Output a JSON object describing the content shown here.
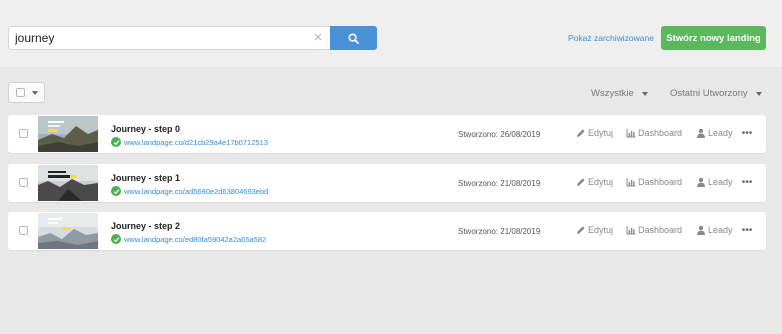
{
  "search": {
    "value": "journey",
    "clear_symbol": "×"
  },
  "header": {
    "archived_link": "Pokaż zarchiwizowane",
    "create_button": "Stwórz nowy landing"
  },
  "filters": {
    "status": "Wszystkie",
    "sort": "Ostatni Utworzony"
  },
  "actions": {
    "edit": "Edytuj",
    "dashboard": "Dashboard",
    "leads": "Leady",
    "more": "•••"
  },
  "landings": [
    {
      "name": "Journey - step 0",
      "url": "www.landpage.co/d21cb29a4e17b0712513",
      "created": "Stworzono: 26/08/2019"
    },
    {
      "name": "Journey - step 1",
      "url": "www.landpage.co/ad5690e2d63804693ebd",
      "created": "Stworzono: 21/08/2019"
    },
    {
      "name": "Journey - step 2",
      "url": "www.landpage.co/ed80fa59042a2a65a582",
      "created": "Stworzono: 21/08/2019"
    }
  ],
  "icons": {
    "search": "search-icon",
    "clear": "close-icon",
    "check": "check-circle-icon",
    "edit": "pencil-icon",
    "dashboard": "bar-chart-icon",
    "leads": "user-icon",
    "more": "ellipsis-icon"
  },
  "colors": {
    "primary": "#4a90d9",
    "success": "#5cb85c",
    "link": "#3c8ccf",
    "check": "#4caf50"
  }
}
